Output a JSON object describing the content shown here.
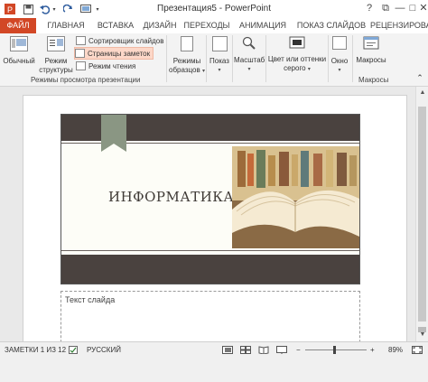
{
  "window": {
    "title": "Презентация5 - PowerPoint",
    "help": "?",
    "restore": "⧉",
    "minimize": "—",
    "maximize": "□",
    "close": "✕"
  },
  "quick_access": {
    "save_icon": "save-icon",
    "undo_icon": "undo-icon",
    "redo_icon": "redo-icon",
    "start_icon": "start-from-beginning-icon"
  },
  "tabs": {
    "file": "ФАЙЛ",
    "home": "ГЛАВНАЯ",
    "insert": "ВСТАВКА",
    "design": "ДИЗАЙН",
    "transitions": "ПЕРЕХОДЫ",
    "animations": "АНИМАЦИЯ",
    "slideshow": "ПОКАЗ СЛАЙДОВ",
    "review": "РЕЦЕНЗИРОВА"
  },
  "ribbon": {
    "normal": "Обычный",
    "outline_1": "Режим",
    "outline_2": "структуры",
    "slide_sorter": "Сортировщик слайдов",
    "notes_page": "Страницы заметок",
    "reading_view": "Режим чтения",
    "group_views": "Режимы просмотра презентации",
    "master_views_1": "Режимы",
    "master_views_2": "образцов",
    "show": "Показ",
    "zoom": "Масштаб",
    "color_1": "Цвет или оттенки",
    "color_2": "серого",
    "window": "Окно",
    "macros": "Макросы",
    "group_macros": "Макросы",
    "collapse": "⌃"
  },
  "slide": {
    "title": "ИНФОРМАТИКА"
  },
  "notes": {
    "text": "Текст  слайда"
  },
  "statusbar": {
    "notes_count": "ЗАМЕТКИ 1 ИЗ 12",
    "language": "РУССКИЙ",
    "zoom_minus": "−",
    "zoom_plus": "+",
    "zoom_percent": "89%"
  },
  "colors": {
    "file_tab": "#d24726",
    "slide_band": "#4a423f",
    "bookmark": "#8a9683",
    "selected_button": "#fcd7c8"
  }
}
